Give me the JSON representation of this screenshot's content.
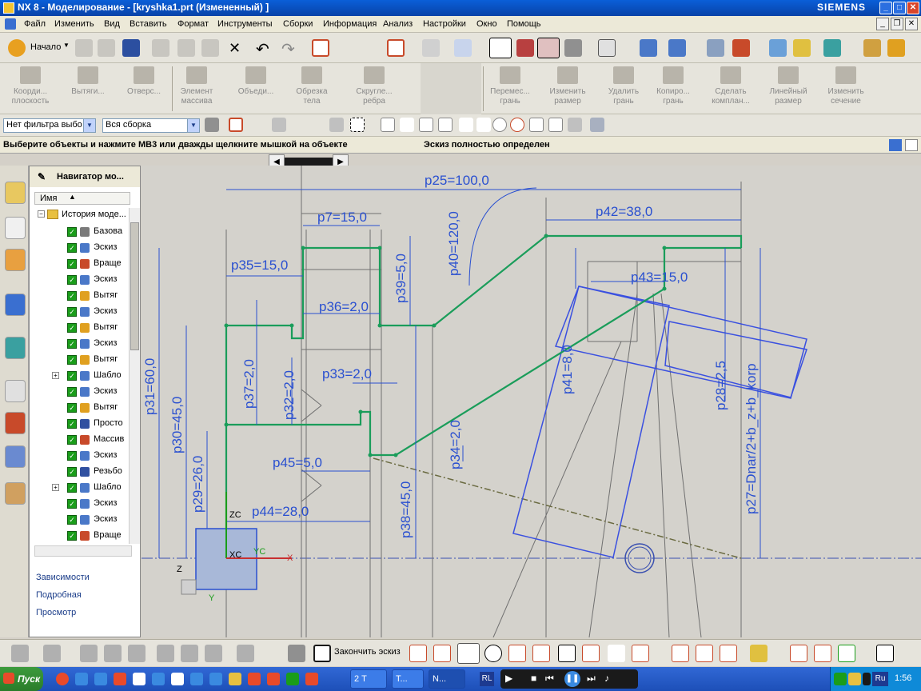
{
  "window": {
    "title": "NX 8 - Моделирование - [kryshka1.prt (Измененный) ]",
    "brand": "SIEMENS"
  },
  "menu": [
    "Файл",
    "Изменить",
    "Вид",
    "Вставить",
    "Формат",
    "Инструменты",
    "Сборки",
    "Информация",
    "Анализ",
    "Настройки",
    "Окно",
    "Помощь"
  ],
  "toolbar1": {
    "start_label": "Начало"
  },
  "toolbar2": {
    "left": [
      {
        "l1": "Коорди...",
        "l2": "плоскость"
      },
      {
        "l1": "Вытяги...",
        "l2": ""
      },
      {
        "l1": "Отверс...",
        "l2": ""
      },
      {
        "l1": "Элемент",
        "l2": "массива"
      },
      {
        "l1": "Объеди...",
        "l2": ""
      },
      {
        "l1": "Обрезка",
        "l2": "тела"
      },
      {
        "l1": "Скругле...",
        "l2": "ребра"
      }
    ],
    "right": [
      {
        "l1": "Перемес...",
        "l2": "грань"
      },
      {
        "l1": "Изменить",
        "l2": "размер"
      },
      {
        "l1": "Удалить",
        "l2": "грань"
      },
      {
        "l1": "Копиро...",
        "l2": "грань"
      },
      {
        "l1": "Сделать",
        "l2": "комплан..."
      },
      {
        "l1": "Линейный",
        "l2": "размер"
      },
      {
        "l1": "Изменить",
        "l2": "сечение"
      }
    ]
  },
  "filters": {
    "type_filter": "Нет фильтра выбо",
    "assembly_filter": "Вся сборка"
  },
  "cue": {
    "prompt": "Выберите объекты и нажмите MB3 или дважды щелкните мышкой на объекте",
    "status": "Эскиз полностью определен"
  },
  "navigator": {
    "title": "Навигатор мо...",
    "column": "Имя",
    "root": "История моде...",
    "items": [
      {
        "label": "Базова",
        "color": "#7a7a7a",
        "expand": false
      },
      {
        "label": "Эскиз",
        "color": "#4a78c8",
        "expand": false
      },
      {
        "label": "Враще",
        "color": "#c84a2a",
        "expand": false
      },
      {
        "label": "Эскиз",
        "color": "#4a78c8",
        "expand": false
      },
      {
        "label": "Вытяг",
        "color": "#e0a020",
        "expand": false
      },
      {
        "label": "Эскиз",
        "color": "#4a78c8",
        "expand": false
      },
      {
        "label": "Вытяг",
        "color": "#e0a020",
        "expand": false
      },
      {
        "label": "Эскиз",
        "color": "#4a78c8",
        "expand": false
      },
      {
        "label": "Вытяг",
        "color": "#e0a020",
        "expand": false
      },
      {
        "label": "Шабло",
        "color": "#4a78c8",
        "expand": true
      },
      {
        "label": "Эскиз",
        "color": "#4a78c8",
        "expand": false
      },
      {
        "label": "Вытяг",
        "color": "#e0a020",
        "expand": false
      },
      {
        "label": "Просто",
        "color": "#3050a0",
        "expand": false
      },
      {
        "label": "Массив",
        "color": "#c84a2a",
        "expand": false
      },
      {
        "label": "Эскиз",
        "color": "#4a78c8",
        "expand": false
      },
      {
        "label": "Резьбо",
        "color": "#3050a0",
        "expand": false
      },
      {
        "label": "Шабло",
        "color": "#4a78c8",
        "expand": true
      },
      {
        "label": "Эскиз",
        "color": "#4a78c8",
        "expand": false
      },
      {
        "label": "Эскиз",
        "color": "#4a78c8",
        "expand": false
      },
      {
        "label": "Враще",
        "color": "#c84a2a",
        "expand": false
      }
    ],
    "panels": [
      "Зависимости",
      "Подробная",
      "Просмотр"
    ]
  },
  "sketch": {
    "dimensions": {
      "p25": "p25=100,0",
      "p7": "p7=15,0",
      "p42": "p42=38,0",
      "p40": "p40=120,0",
      "p35": "p35=15,0",
      "p39": "p39=5,0",
      "p43": "p43=15,0",
      "p36": "p36=2,0",
      "p31": "p31=60,0",
      "p33": "p33=2,0",
      "p41": "p41=8,0",
      "p28": "p28=2,5",
      "p27": "p27=Dnar/2+b_z+b_korp",
      "p30": "p30=45,0",
      "p37": "p37=2,0",
      "p32": "p32=2,0",
      "p34": "p34=2,0",
      "p45": "p45=5,0",
      "p29": "p29=26,0",
      "p44": "p44=28,0",
      "p38": "p38=45,0"
    },
    "axes": {
      "zc": "ZC",
      "yc": "YC",
      "xc": "XC",
      "z": "Z",
      "y": "Y",
      "x": "X"
    }
  },
  "bottom_toolbar": {
    "finish_sketch": "Закончить эскиз"
  },
  "taskbar": {
    "start": "Пуск",
    "buttons": [
      "2 Т",
      "T...",
      "N..."
    ],
    "lang": "Ru",
    "lang_left": "RL",
    "clock": "1:56"
  }
}
